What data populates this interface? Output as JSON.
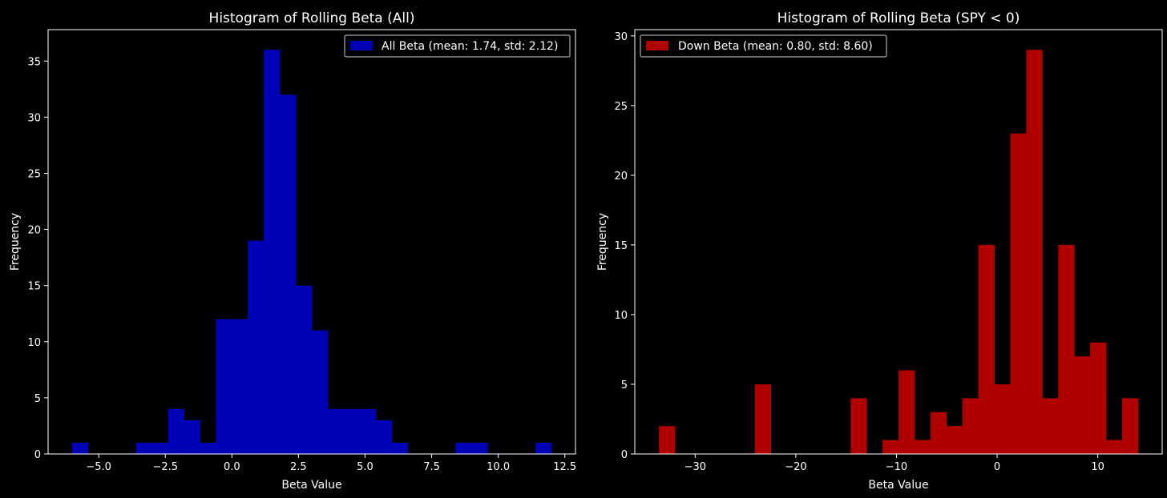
{
  "chart_data": [
    {
      "type": "bar",
      "title": "Histogram of Rolling Beta (All)",
      "xlabel": "Beta Value",
      "ylabel": "Frequency",
      "xlim": [
        -6.9,
        12.9
      ],
      "ylim": [
        0,
        37.8
      ],
      "xticks": [
        -5.0,
        -2.5,
        0.0,
        2.5,
        5.0,
        7.5,
        10.0,
        12.5
      ],
      "xtick_labels": [
        "−5.0",
        "−2.5",
        "0.0",
        "2.5",
        "5.0",
        "7.5",
        "10.0",
        "12.5"
      ],
      "yticks": [
        0,
        5,
        10,
        15,
        20,
        25,
        30,
        35
      ],
      "ytick_labels": [
        "0",
        "5",
        "10",
        "15",
        "20",
        "25",
        "30",
        "35"
      ],
      "bin_start": -6.0,
      "bin_width": 0.6,
      "counts": [
        1,
        0,
        0,
        0,
        1,
        1,
        4,
        3,
        1,
        12,
        12,
        19,
        36,
        32,
        15,
        11,
        4,
        4,
        4,
        3,
        1,
        0,
        0,
        0,
        1,
        1,
        0,
        0,
        0,
        1
      ],
      "color": "#0000b8",
      "legend": {
        "label": "All Beta (mean: 1.74, std: 2.12)",
        "position": "upper right"
      }
    },
    {
      "type": "bar",
      "title": "Histogram of Rolling Beta (SPY < 0)",
      "xlabel": "Beta Value",
      "ylabel": "Frequency",
      "xlim": [
        -36.0,
        16.4
      ],
      "ylim": [
        0,
        30.45
      ],
      "xticks": [
        -30,
        -20,
        -10,
        0,
        10
      ],
      "xtick_labels": [
        "−30",
        "−20",
        "−10",
        "0",
        "10"
      ],
      "yticks": [
        0,
        5,
        10,
        15,
        20,
        25,
        30
      ],
      "ytick_labels": [
        "0",
        "5",
        "10",
        "15",
        "20",
        "25",
        "30"
      ],
      "bin_start": -33.6,
      "bin_width": 1.587,
      "counts": [
        2,
        0,
        0,
        0,
        0,
        0,
        5,
        0,
        0,
        0,
        0,
        0,
        4,
        0,
        1,
        6,
        1,
        3,
        2,
        4,
        15,
        5,
        23,
        29,
        4,
        15,
        7,
        8,
        1,
        4
      ],
      "color": "#b00000",
      "legend": {
        "label": "Down Beta (mean: 0.80, std: 8.60)",
        "position": "upper left"
      }
    }
  ]
}
